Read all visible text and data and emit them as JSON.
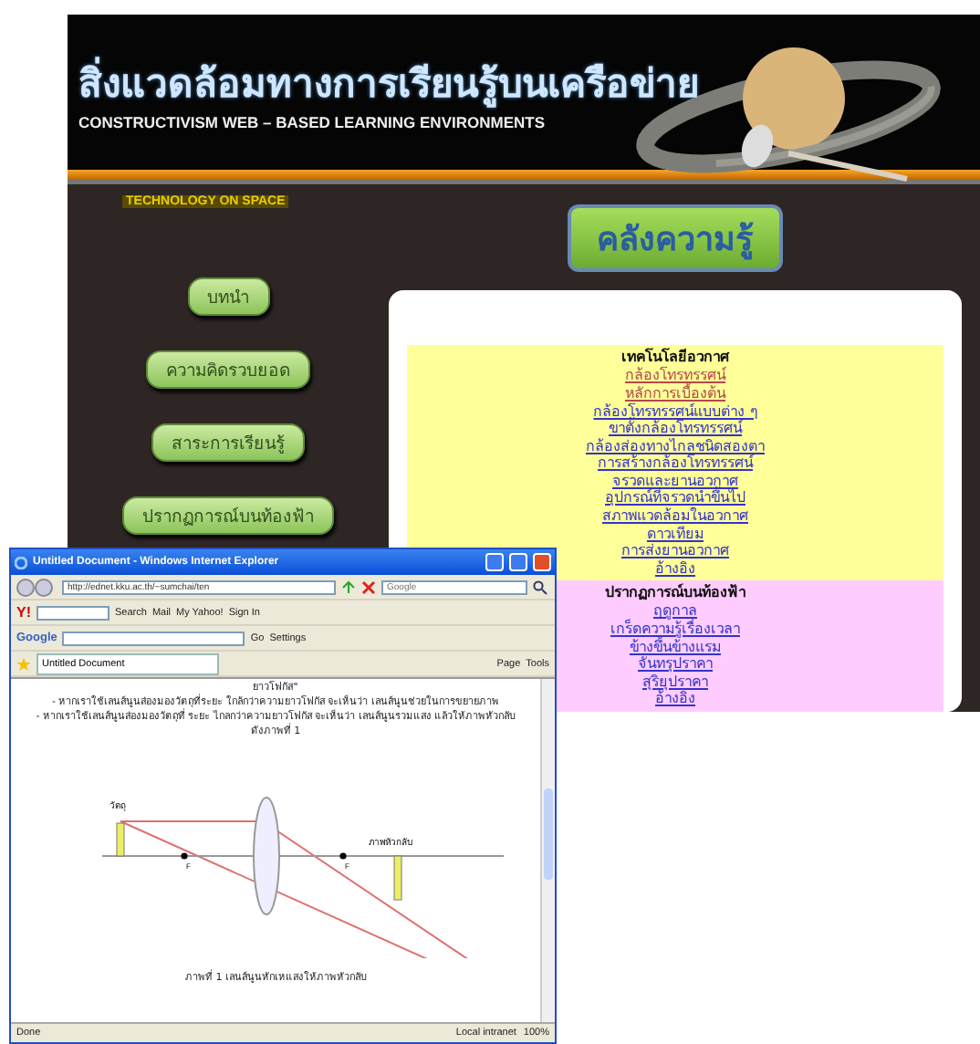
{
  "site": {
    "title": "สิ่งแวดล้อมทางการเรียนรู้บนเครือข่าย",
    "subtitle": "CONSTRUCTIVISM WEB – BASED LEARNING  ENVIRONMENTS",
    "tagline": "TECHNOLOGY ON SPACE",
    "heading_button": "คลังความรู้",
    "nav": [
      "บทนำ",
      "ความคิดรวบยอด",
      "สาระการเรียนรู้",
      "ปรากฏการณ์บนท้องฟ้า"
    ],
    "sections": [
      {
        "title": "เทคโนโลยีอวกาศ",
        "color": "#ffff99",
        "links": [
          {
            "label": "กล้องโทรทรรศน์",
            "visited": true
          },
          {
            "label": "หลักการเบื้องต้น",
            "visited": true
          },
          {
            "label": "กล้องโทรทรรศน์แบบต่าง ๆ",
            "visited": false
          },
          {
            "label": "ขาตั้งกล้องโทรทรรศน์",
            "visited": false
          },
          {
            "label": "กล้องส่องทางไกลชนิดสองตา",
            "visited": false
          },
          {
            "label": "การสร้างกล้องโทรทรรศน์",
            "visited": false
          },
          {
            "label": "จรวดและยานอวกาศ",
            "visited": false
          },
          {
            "label": "อุปกรณ์ที่จรวดนำขึ้นไป",
            "visited": false
          },
          {
            "label": "สภาพแวดล้อมในอวกาศ",
            "visited": false
          },
          {
            "label": "ดาวเทียม",
            "visited": false
          },
          {
            "label": "การส่งยานอวกาศ",
            "visited": false
          },
          {
            "label": "อ้างอิง",
            "visited": false
          }
        ]
      },
      {
        "title": "ปรากฏการณ์บนท้องฟ้า",
        "color": "#ffccff",
        "links": [
          {
            "label": "ฤดูกาล",
            "visited": false
          },
          {
            "label": "เกร็ดความรู้เรื่องเวลา",
            "visited": false
          },
          {
            "label": "ข้างขึ้นข้างแรม",
            "visited": false
          },
          {
            "label": "จันทรุปราคา",
            "visited": false
          },
          {
            "label": "สุริยุปราคา",
            "visited": false
          },
          {
            "label": "อ้างอิง",
            "visited": false
          }
        ]
      }
    ]
  },
  "browser": {
    "title": "Untitled Document - Windows Internet Explorer",
    "address": "http://ednet.kku.ac.th/~sumchai/ten",
    "search_placeholder": "Google",
    "yahoo_logo": "Y!",
    "yahoo_toolbar": [
      "Search",
      "Mail",
      "My Yahoo!",
      "Sign In"
    ],
    "google_logo": "Google",
    "google_toolbar": [
      "Go",
      "Settings"
    ],
    "tab": "Untitled Document",
    "command_bar": [
      "Page",
      "Tools"
    ],
    "content": {
      "paragraphs": [
        "ยาวโฟกัส\"",
        "- หากเราใช้เลนส์นูนส่องมองวัตถุที่ระยะ ใกล้กว่าความยาวโฟกัส จะเห็นว่า เลนส์นูนช่วยในการขยายภาพ",
        "- หากเราใช้เลนส์นูนส่องมองวัตถุที่ ระยะ ไกลกว่าความยาวโฟกัส จะเห็นว่า เลนส์นูนรวมแสง แล้วให้ภาพหัวกลับ ดังภาพที่ 1"
      ],
      "figure": {
        "object_label": "วัตถุ",
        "image_label": "ภาพหัวกลับ",
        "focal_marks": [
          "F",
          "F"
        ],
        "caption": "ภาพที่ 1 เลนส์นูนหักเหแสงให้ภาพหัวกลับ"
      }
    },
    "status_bar": {
      "status": "Done",
      "zone": "Local intranet",
      "zoom": "100%"
    }
  }
}
